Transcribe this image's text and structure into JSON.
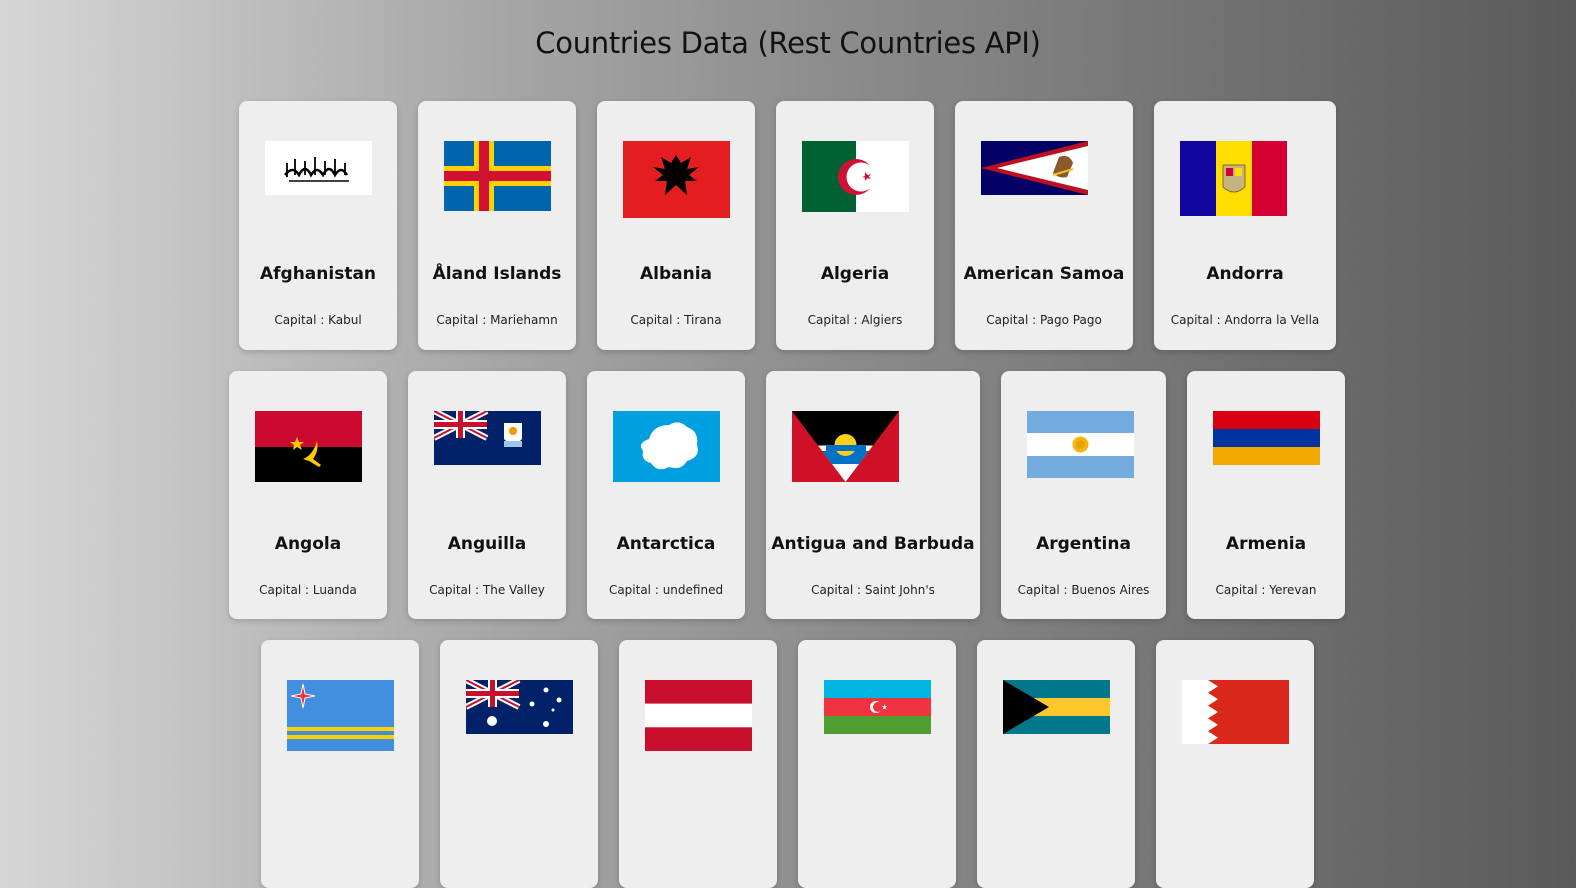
{
  "title": "Countries Data (Rest Countries API)",
  "cap_prefix": "Capital : ",
  "countries": [
    {
      "name": "Afghanistan",
      "capital": "Kabul",
      "flag_icon": "afghanistan-flag-icon"
    },
    {
      "name": "Åland Islands",
      "capital": "Mariehamn",
      "flag_icon": "aland-islands-flag-icon"
    },
    {
      "name": "Albania",
      "capital": "Tirana",
      "flag_icon": "albania-flag-icon"
    },
    {
      "name": "Algeria",
      "capital": "Algiers",
      "flag_icon": "algeria-flag-icon"
    },
    {
      "name": "American Samoa",
      "capital": "Pago Pago",
      "flag_icon": "american-samoa-flag-icon"
    },
    {
      "name": "Andorra",
      "capital": "Andorra la Vella",
      "flag_icon": "andorra-flag-icon"
    },
    {
      "name": "Angola",
      "capital": "Luanda",
      "flag_icon": "angola-flag-icon"
    },
    {
      "name": "Anguilla",
      "capital": "The Valley",
      "flag_icon": "anguilla-flag-icon"
    },
    {
      "name": "Antarctica",
      "capital": "undefined",
      "flag_icon": "antarctica-flag-icon"
    },
    {
      "name": "Antigua and Barbuda",
      "capital": "Saint John's",
      "flag_icon": "antigua-and-barbuda-flag-icon"
    },
    {
      "name": "Argentina",
      "capital": "Buenos Aires",
      "flag_icon": "argentina-flag-icon"
    },
    {
      "name": "Armenia",
      "capital": "Yerevan",
      "flag_icon": "armenia-flag-icon"
    },
    {
      "flag_icon": "aruba-flag-icon"
    },
    {
      "flag_icon": "australia-flag-icon"
    },
    {
      "flag_icon": "austria-flag-icon"
    },
    {
      "flag_icon": "azerbaijan-flag-icon"
    },
    {
      "flag_icon": "bahamas-flag-icon"
    },
    {
      "flag_icon": "bahrain-flag-icon"
    }
  ]
}
